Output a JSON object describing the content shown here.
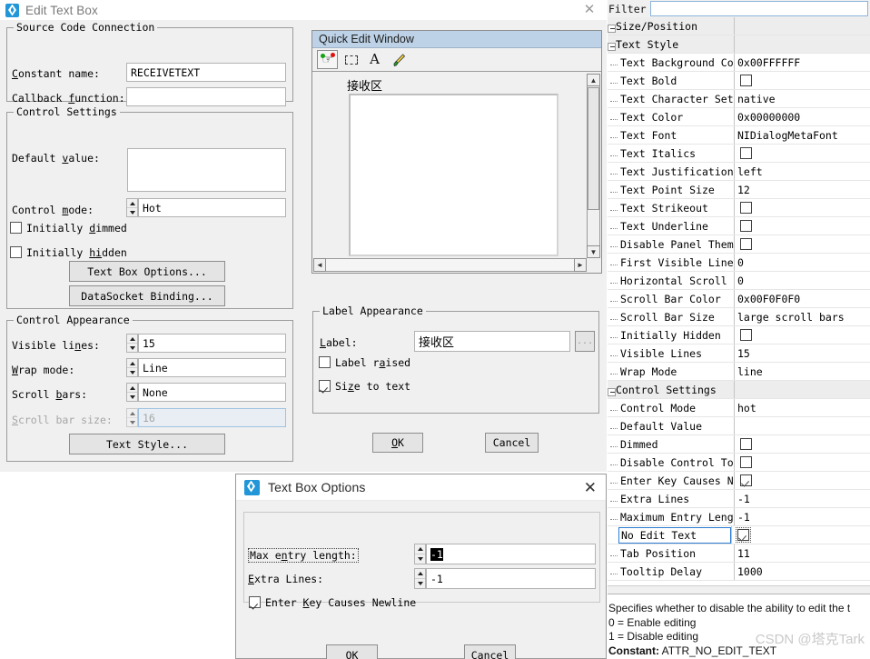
{
  "main_dialog": {
    "title": "Edit Text Box",
    "logo_icon": "ni-diamond-icon",
    "close_icon": "close-icon",
    "groups": {
      "source_code_connection": {
        "title": "Source Code Connection",
        "constant_name_label": "Constant name:",
        "constant_name_value": "RECEIVETEXT",
        "callback_function_label": "Callback function:",
        "callback_function_value": ""
      },
      "control_settings": {
        "title": "Control Settings",
        "default_value_label": "Default value:",
        "default_value": "",
        "control_mode_label": "Control mode:",
        "control_mode_value": "Hot",
        "initially_dimmed_label": "Initially dimmed",
        "initially_dimmed_checked": false,
        "initially_hidden_label": "Initially hidden",
        "initially_hidden_checked": false,
        "text_box_options_button": "Text Box Options...",
        "datasocket_binding_button": "DataSocket Binding..."
      },
      "control_appearance": {
        "title": "Control Appearance",
        "visible_lines_label": "Visible lines:",
        "visible_lines_value": "15",
        "wrap_mode_label": "Wrap mode:",
        "wrap_mode_value": "Line",
        "scroll_bars_label": "Scroll bars:",
        "scroll_bars_value": "None",
        "scroll_bar_size_label": "Scroll bar size:",
        "scroll_bar_size_value": "16",
        "text_style_button": "Text Style..."
      },
      "label_appearance": {
        "title": "Label Appearance",
        "label_label": "Label:",
        "label_value": "接收区",
        "browse_button": "...",
        "label_raised_label": "Label raised",
        "label_raised_checked": false,
        "size_to_text_label": "Size to text",
        "size_to_text_checked": true
      }
    },
    "ok_button": "OK",
    "cancel_button": "Cancel"
  },
  "quick_edit_window": {
    "title": "Quick Edit Window",
    "toolbar": [
      {
        "name": "operate-tool-icon",
        "glyph": "hand"
      },
      {
        "name": "select-tool-icon",
        "glyph": "dashed-rect"
      },
      {
        "name": "label-tool-icon",
        "glyph": "A"
      },
      {
        "name": "color-tool-icon",
        "glyph": "brush"
      }
    ],
    "control_label": "接收区",
    "control_text": ""
  },
  "properties_panel": {
    "filter_label": "Filter",
    "filter_value": "",
    "rows": [
      {
        "name": "Size/Position",
        "value": "",
        "type": "category"
      },
      {
        "name": "Text Style",
        "value": "",
        "type": "category"
      },
      {
        "name": "Text Background Color",
        "value": "0x00FFFFFF",
        "type": "text",
        "indent": 2
      },
      {
        "name": "Text Bold",
        "value": "",
        "type": "checkbox",
        "checked": false,
        "indent": 2
      },
      {
        "name": "Text Character Set",
        "value": "native",
        "type": "text",
        "indent": 2
      },
      {
        "name": "Text Color",
        "value": "0x00000000",
        "type": "text",
        "indent": 2
      },
      {
        "name": "Text Font",
        "value": "NIDialogMetaFont",
        "type": "text",
        "indent": 2
      },
      {
        "name": "Text Italics",
        "value": "",
        "type": "checkbox",
        "checked": false,
        "indent": 2
      },
      {
        "name": "Text Justification",
        "value": "left",
        "type": "text",
        "indent": 2
      },
      {
        "name": "Text Point Size",
        "value": "12",
        "type": "text",
        "indent": 2
      },
      {
        "name": "Text Strikeout",
        "value": "",
        "type": "checkbox",
        "checked": false,
        "indent": 2
      },
      {
        "name": "Text Underline",
        "value": "",
        "type": "checkbox",
        "checked": false,
        "indent": 2
      },
      {
        "name": "Disable Panel Theme",
        "value": "",
        "type": "checkbox",
        "checked": false,
        "indent": 1
      },
      {
        "name": "First Visible Line",
        "value": "0",
        "type": "text",
        "indent": 1
      },
      {
        "name": "Horizontal Scroll Offset",
        "value": "0",
        "type": "text",
        "indent": 1
      },
      {
        "name": "Scroll Bar Color",
        "value": "0x00F0F0F0",
        "type": "text",
        "indent": 1
      },
      {
        "name": "Scroll Bar Size",
        "value": "large scroll bars",
        "type": "text",
        "indent": 1
      },
      {
        "name": "Initially Hidden",
        "value": "",
        "type": "checkbox",
        "checked": false,
        "indent": 1
      },
      {
        "name": "Visible Lines",
        "value": "15",
        "type": "text",
        "indent": 1
      },
      {
        "name": "Wrap Mode",
        "value": "line",
        "type": "text",
        "indent": 1
      },
      {
        "name": "Control Settings",
        "value": "",
        "type": "category"
      },
      {
        "name": "Control Mode",
        "value": "hot",
        "type": "text",
        "indent": 1
      },
      {
        "name": "Default Value",
        "value": "",
        "type": "text",
        "indent": 1
      },
      {
        "name": "Dimmed",
        "value": "",
        "type": "checkbox",
        "checked": false,
        "indent": 1
      },
      {
        "name": "Disable Control Tooltip",
        "value": "",
        "type": "checkbox",
        "checked": false,
        "indent": 1
      },
      {
        "name": "Enter Key Causes Newline",
        "value": "",
        "type": "checkbox",
        "checked": true,
        "indent": 1
      },
      {
        "name": "Extra Lines",
        "value": "-1",
        "type": "text",
        "indent": 1
      },
      {
        "name": "Maximum Entry Length",
        "value": "-1",
        "type": "text",
        "indent": 1
      },
      {
        "name": "No Edit Text",
        "value": "",
        "type": "checkbox",
        "checked": true,
        "indent": 1,
        "selected": true
      },
      {
        "name": "Tab Position",
        "value": "11",
        "type": "text",
        "indent": 1
      },
      {
        "name": "Tooltip Delay",
        "value": "1000",
        "type": "text",
        "indent": 1
      }
    ],
    "description": {
      "line1": "Specifies whether to disable the ability to edit the t",
      "line2": "0 = Enable editing",
      "line3": "1 = Disable editing",
      "constant_label": "Constant:",
      "constant_value": "ATTR_NO_EDIT_TEXT"
    },
    "watermark": "CSDN @塔克Tark"
  },
  "text_box_options_dialog": {
    "title": "Text Box Options",
    "logo_icon": "ni-diamond-icon",
    "close_icon": "close-icon",
    "max_entry_length_label": "Max entry length:",
    "max_entry_length_value": "-1",
    "extra_lines_label": "Extra Lines:",
    "extra_lines_value": "-1",
    "enter_key_label": "Enter Key Causes Newline",
    "enter_key_checked": true,
    "ok_button": "OK",
    "cancel_button": "Cancel"
  },
  "colors": {
    "dialog_bg": "#f0f0f0",
    "qew_title_bg": "#bdd2e6",
    "selection_blue": "#2b7cd3",
    "accent_logo": "#2196d8"
  }
}
